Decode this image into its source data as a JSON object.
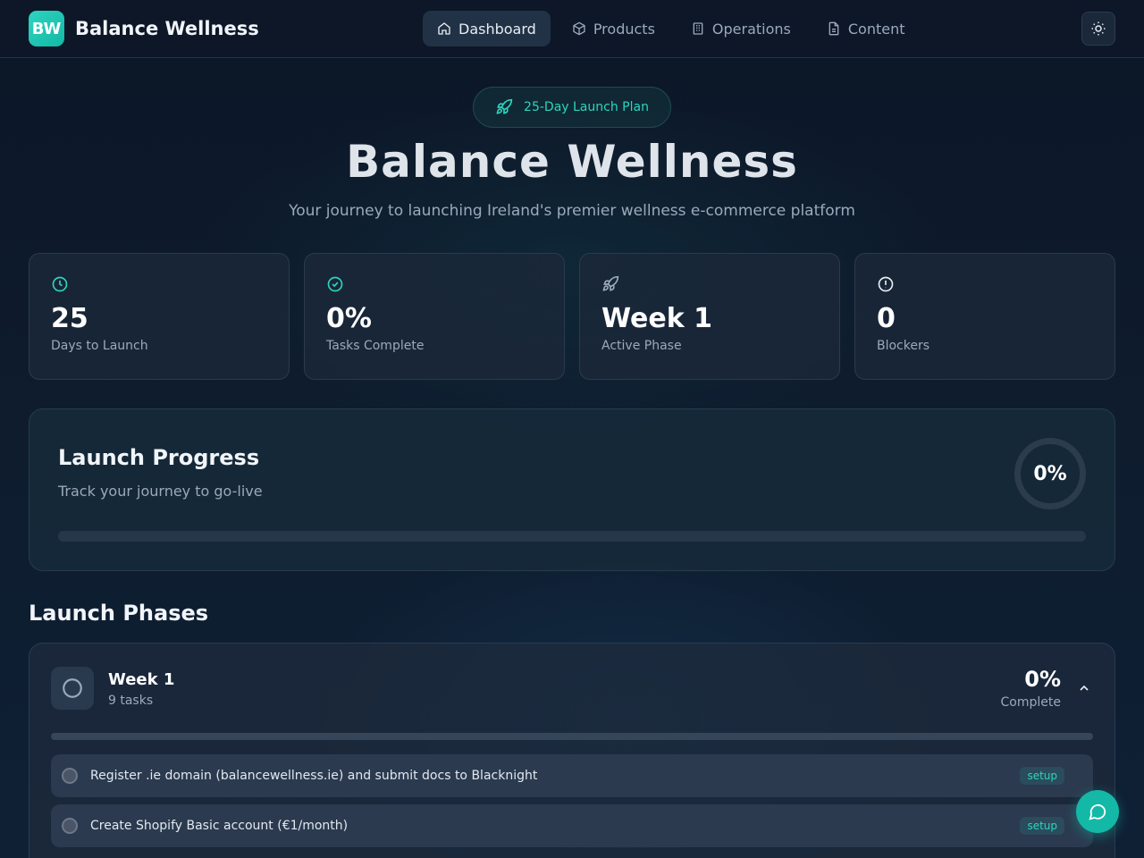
{
  "header": {
    "logo_text": "BW",
    "brand": "Balance Wellness",
    "nav": [
      {
        "label": "Dashboard",
        "icon": "home-icon"
      },
      {
        "label": "Products",
        "icon": "box-icon"
      },
      {
        "label": "Operations",
        "icon": "building-icon"
      },
      {
        "label": "Content",
        "icon": "file-icon"
      }
    ],
    "theme_icon": "sun-icon"
  },
  "hero": {
    "badge": "25-Day Launch Plan",
    "title": "Balance Wellness",
    "subtitle": "Your journey to launching Ireland's premier wellness e-commerce platform"
  },
  "stats": [
    {
      "value": "25",
      "label": "Days to Launch",
      "icon": "clock-icon"
    },
    {
      "value": "0%",
      "label": "Tasks Complete",
      "icon": "check-circle-icon"
    },
    {
      "value": "Week 1",
      "label": "Active Phase",
      "icon": "rocket-icon"
    },
    {
      "value": "0",
      "label": "Blockers",
      "icon": "alert-circle-icon"
    }
  ],
  "progress": {
    "title": "Launch Progress",
    "subtitle": "Track your journey to go-live",
    "percent_text": "0%",
    "percent": 0
  },
  "phases": {
    "title": "Launch Phases",
    "items": [
      {
        "name": "Week 1",
        "count": "9 tasks",
        "percent_text": "0%",
        "percent_label": "Complete",
        "percent": 0,
        "tasks": [
          {
            "text": "Register .ie domain (balancewellness.ie) and submit docs to Blacknight",
            "tag": "setup"
          },
          {
            "text": "Create Shopify Basic account (€1/month)",
            "tag": "setup"
          }
        ]
      }
    ]
  },
  "colors": {
    "accent": "#2dd4bf",
    "background": "#0e1c2e"
  }
}
